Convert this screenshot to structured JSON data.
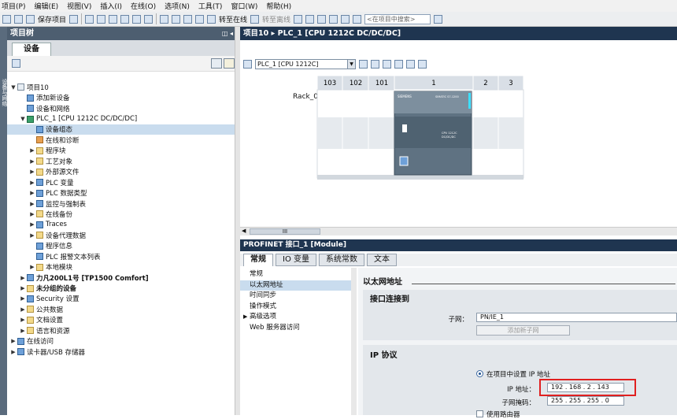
{
  "menubar": [
    "项目(P)",
    "编辑(E)",
    "视图(V)",
    "插入(I)",
    "在线(O)",
    "选项(N)",
    "工具(T)",
    "窗口(W)",
    "帮助(H)"
  ],
  "toolbar": {
    "save_project": "保存项目",
    "go_online": "转至在线",
    "go_offline": "转至离线",
    "search_placeholder": "<在项目中搜索>"
  },
  "left_strip": "设备与网络",
  "project_tree": {
    "title": "项目树",
    "tab": "设备",
    "collapse_ctrl": "◫ ◂",
    "items": [
      {
        "label": "项目10",
        "arrow": "▼",
        "bold": false
      },
      {
        "label": "添加新设备",
        "arrow": "",
        "bold": false
      },
      {
        "label": "设备和网络",
        "arrow": "",
        "bold": false
      },
      {
        "label": "PLC_1 [CPU 1212C DC/DC/DC]",
        "arrow": "▼",
        "bold": false
      },
      {
        "label": "设备组态",
        "arrow": "",
        "bold": false
      },
      {
        "label": "在线和诊断",
        "arrow": "",
        "bold": false
      },
      {
        "label": "程序块",
        "arrow": "▶",
        "bold": false
      },
      {
        "label": "工艺对象",
        "arrow": "▶",
        "bold": false
      },
      {
        "label": "外部源文件",
        "arrow": "▶",
        "bold": false
      },
      {
        "label": "PLC 变量",
        "arrow": "▶",
        "bold": false
      },
      {
        "label": "PLC 数据类型",
        "arrow": "▶",
        "bold": false
      },
      {
        "label": "监控与强制表",
        "arrow": "▶",
        "bold": false
      },
      {
        "label": "在线备份",
        "arrow": "▶",
        "bold": false
      },
      {
        "label": "Traces",
        "arrow": "▶",
        "bold": false
      },
      {
        "label": "设备代理数据",
        "arrow": "▶",
        "bold": false
      },
      {
        "label": "程序信息",
        "arrow": "",
        "bold": false
      },
      {
        "label": "PLC 报警文本列表",
        "arrow": "",
        "bold": false
      },
      {
        "label": "本地模块",
        "arrow": "▶",
        "bold": false
      },
      {
        "label": "力凡200L1号 [TP1500 Comfort]",
        "arrow": "▶",
        "bold": true
      },
      {
        "label": "未分组的设备",
        "arrow": "▶",
        "bold": true
      },
      {
        "label": "Security 设置",
        "arrow": "▶",
        "bold": false
      },
      {
        "label": "公共数据",
        "arrow": "▶",
        "bold": false
      },
      {
        "label": "文档设置",
        "arrow": "▶",
        "bold": false
      },
      {
        "label": "语言和资源",
        "arrow": "▶",
        "bold": false
      },
      {
        "label": "在线访问",
        "arrow": "▶",
        "bold": false
      },
      {
        "label": "读卡器/USB 存储器",
        "arrow": "▶",
        "bold": false
      }
    ]
  },
  "main": {
    "title": "项目10 ▸ PLC_1 [CPU 1212C DC/DC/DC]",
    "device_select": "PLC_1 [CPU 1212C]",
    "rack": {
      "label": "Rack_0",
      "slots": [
        "103",
        "102",
        "101",
        "1",
        "2",
        "3"
      ],
      "module_brand": "SIEMENS",
      "module_name": "SIMATIC S7-1200",
      "module_cpu": "CPU 1212C",
      "module_order": "DC/DC/DC"
    },
    "scroll_label": "III"
  },
  "inspector": {
    "title": "PROFINET 接口_1 [Module]",
    "tabs": [
      "常规",
      "IO 变量",
      "系统常数",
      "文本"
    ],
    "nav": [
      {
        "label": "常规",
        "arrow": ""
      },
      {
        "label": "以太网地址",
        "arrow": ""
      },
      {
        "label": "时间同步",
        "arrow": ""
      },
      {
        "label": "操作模式",
        "arrow": ""
      },
      {
        "label": "高级选项",
        "arrow": "▶"
      },
      {
        "label": "Web 服务器访问",
        "arrow": ""
      }
    ],
    "section_title": "以太网地址",
    "interface_network": {
      "title": "接口连接到",
      "subnet_label": "子网：",
      "subnet_value": "PN/IE_1",
      "add_subnet_button": "添加新子网"
    },
    "ip_protocol": {
      "title": "IP 协议",
      "radio_label": "在项目中设置 IP 地址",
      "ip_label": "IP 地址：",
      "ip_value": "192 . 168 . 2   . 143",
      "mask_label": "子网掩码：",
      "mask_value": "255 . 255 . 255 . 0",
      "router_label": "使用路由器"
    }
  },
  "colors": {
    "title_bar": "#1f3550",
    "panel_title": "#4d5e70",
    "selection": "#c9dcee",
    "highlight": "#e02020",
    "module": "#5f7282"
  }
}
